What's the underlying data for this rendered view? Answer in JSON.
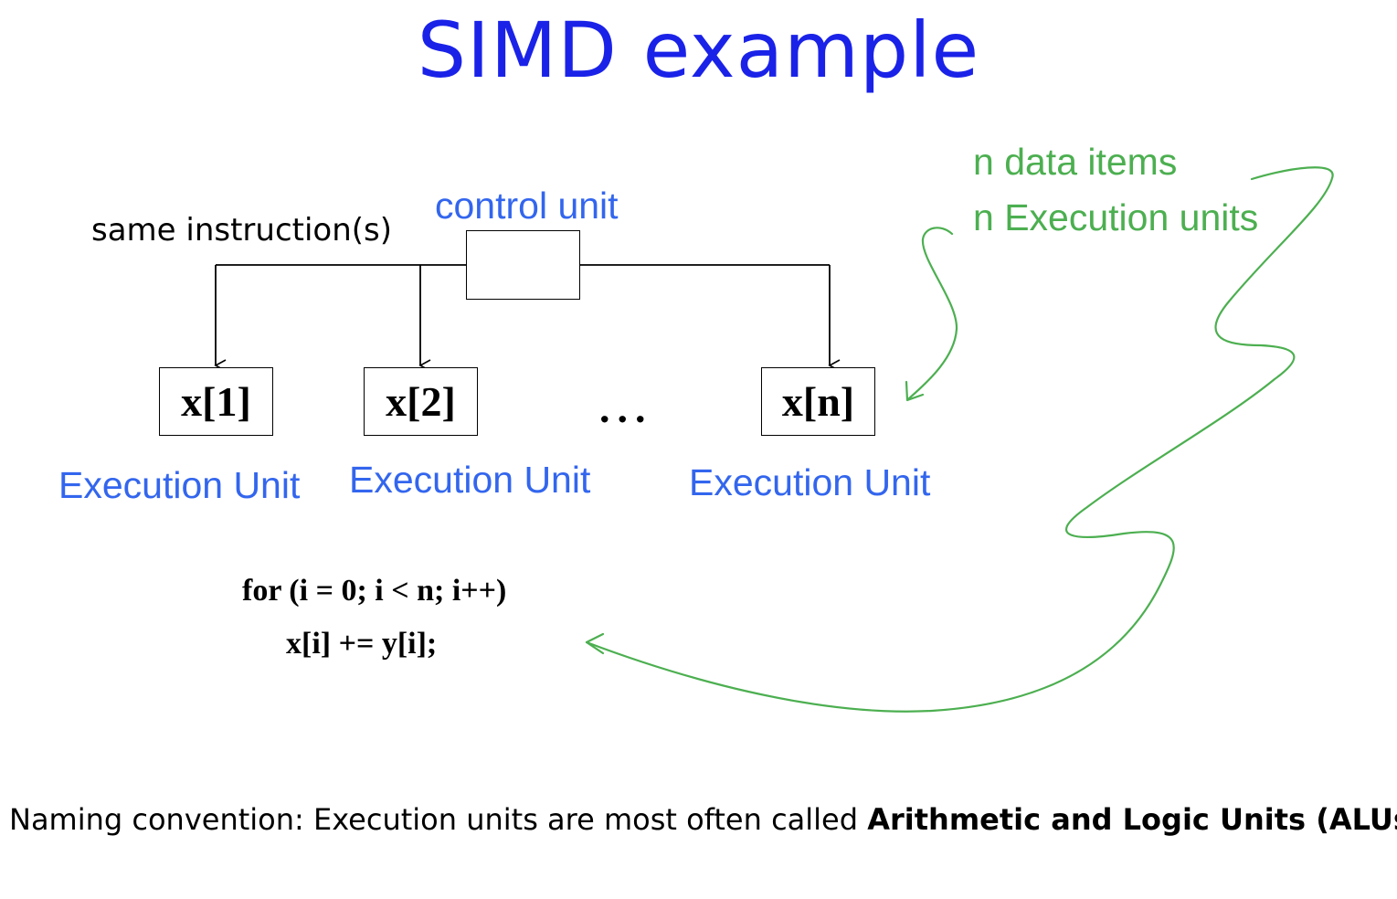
{
  "title": "SIMD example",
  "diagram": {
    "instruction_label": "same instruction(s)",
    "control_unit_label": "control unit",
    "units": [
      {
        "value": "x[1]",
        "caption": "Execution Unit"
      },
      {
        "value": "x[2]",
        "caption": "Execution Unit"
      },
      {
        "value": "x[n]",
        "caption": "Execution Unit"
      }
    ],
    "ellipsis": "...",
    "annotations": [
      "n data items",
      "n Execution units"
    ]
  },
  "code": {
    "line1": "for (i = 0; i < n; i++)",
    "line2": "x[i] += y[i];"
  },
  "footer": {
    "text": "Naming convention: Execution units are most often called ",
    "bold": "Arithmetic and Logic Units (ALUs)"
  },
  "colors": {
    "title": "#1a22e8",
    "blue_labels": "#3366ee",
    "green_annotations": "#4caf50",
    "lines": "#000000"
  }
}
